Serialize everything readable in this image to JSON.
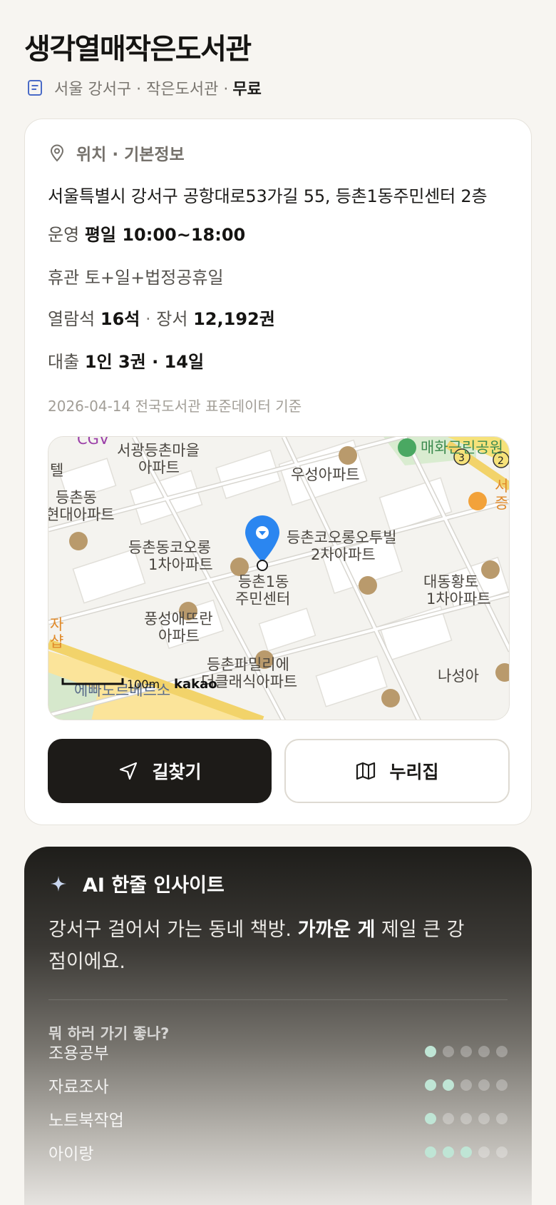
{
  "library": {
    "name": "생각열매작은도서관",
    "region": "서울 강서구 · 작은도서관 ·",
    "fee": "무료"
  },
  "info": {
    "section_title": "위치 · 기본정보",
    "address": "서울특별시 강서구 공항대로53가길 55, 등촌1동주민센터 2층",
    "hours_label": "운영",
    "hours_value": "평일 10:00~18:00",
    "closed_label": "휴관",
    "closed_value": "토+일+법정공휴일",
    "seats_label": "열람석",
    "seats_value": "16석",
    "books_label": "장서",
    "books_value": "12,192권",
    "loan_label": "대출",
    "loan_value": "1인 3권 · 14일",
    "data_basis": "2026-04-14 전국도서관 표준데이터 기준"
  },
  "map": {
    "labels": {
      "l1": "서광등촌마을",
      "l1b": "아파트",
      "l2": "우성아파트",
      "l3": "매화근린공원",
      "l4": "등촌동",
      "l4b": "현대아파트",
      "l5": "등촌동코오롱",
      "l5b": "1차아파트",
      "l6": "등촌코오롱오투빌",
      "l6b": "2차아파트",
      "l7": "등촌1동",
      "l7b": "주민센터",
      "l8": "대동황토",
      "l8b": "1차아파트",
      "l9": "풍성애뜨란",
      "l9b": "아파트",
      "l10": "등촌파밀리에",
      "l10b": "더클래식아파트",
      "l11": "나성아",
      "l12": "에빠도르베르소",
      "l13": "CGV",
      "l14": "자",
      "l14b": "샵",
      "l15": "서",
      "l15b": "증",
      "l16": "텔"
    },
    "scale": "100m",
    "provider": "kakao",
    "road_badges": [
      "3",
      "2"
    ]
  },
  "actions": {
    "directions": "길찾기",
    "website": "누리집"
  },
  "insight": {
    "title": "AI 한줄 인사이트",
    "text_pre": "강서구 걸어서 가는 동네 책방. ",
    "text_bold": "가까운 게",
    "text_post": " 제일 큰 강점이에요.",
    "question": "뭐 하러 가기 좋나?",
    "purposes": [
      {
        "label": "조용공부",
        "score": 1
      },
      {
        "label": "자료조사",
        "score": 2
      },
      {
        "label": "노트북작업",
        "score": 1
      },
      {
        "label": "아이랑",
        "score": 3
      }
    ]
  },
  "colors": {
    "accent_dot": "#bfe5d5",
    "map_pin": "#2b86f0",
    "dark_button": "#1d1b18"
  }
}
